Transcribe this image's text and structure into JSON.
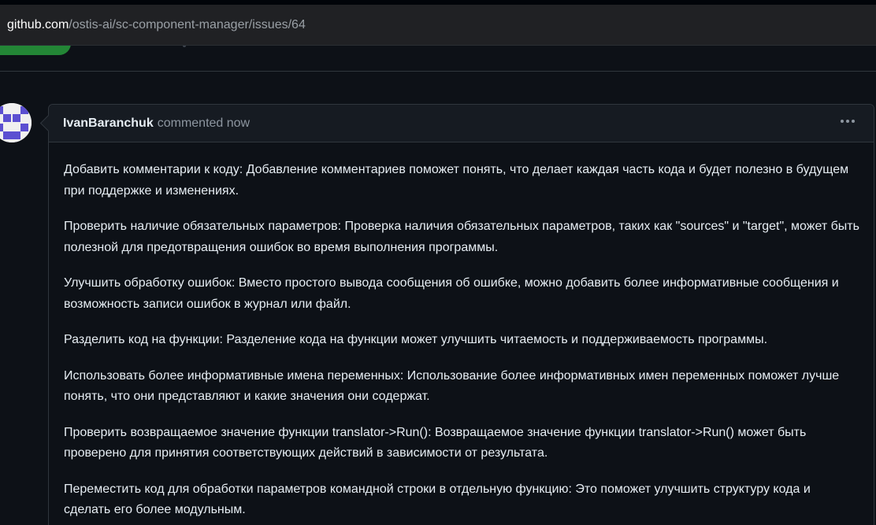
{
  "browser": {
    "url_domain": "github.com",
    "url_path": "/ostis-ai/sc-component-manager/issues/64"
  },
  "comment": {
    "author": "IvanBaranchuk",
    "action": "commented now",
    "menu_icon": "kebab-horizontal-icon",
    "paragraphs": [
      "Добавить комментарии к коду: Добавление комментариев поможет понять, что делает каждая часть кода и будет полезно в будущем при поддержке и изменениях.",
      "Проверить наличие обязательных параметров: Проверка наличия обязательных параметров, таких как \"sources\" и \"target\", может быть полезной для предотвращения ошибок во время выполнения программы.",
      "Улучшить обработку ошибок: Вместо простого вывода сообщения об ошибке, можно добавить более информативные сообщения и возможность записи ошибок в журнал или файл.",
      "Разделить код на функции: Разделение кода на функции может улучшить читаемость и поддерживаемость программы.",
      "Использовать более информативные имена переменных: Использование более информативных имен переменных поможет лучше понять, что они представляют и какие значения они содержат.",
      "Проверить возвращаемое значение функции translator->Run(): Возвращаемое значение функции translator->Run() может быть проверено для принятия соответствующих действий в зависимости от результата.",
      "Переместить код для обработки параметров командной строки в отдельную функцию: Это поможет улучшить структуру кода и сделать его более модульным."
    ]
  },
  "colors": {
    "background": "#0d1117",
    "header_bg": "#161b22",
    "border": "#30363d",
    "muted_text": "#8d96a0",
    "primary_button": "#238636"
  }
}
